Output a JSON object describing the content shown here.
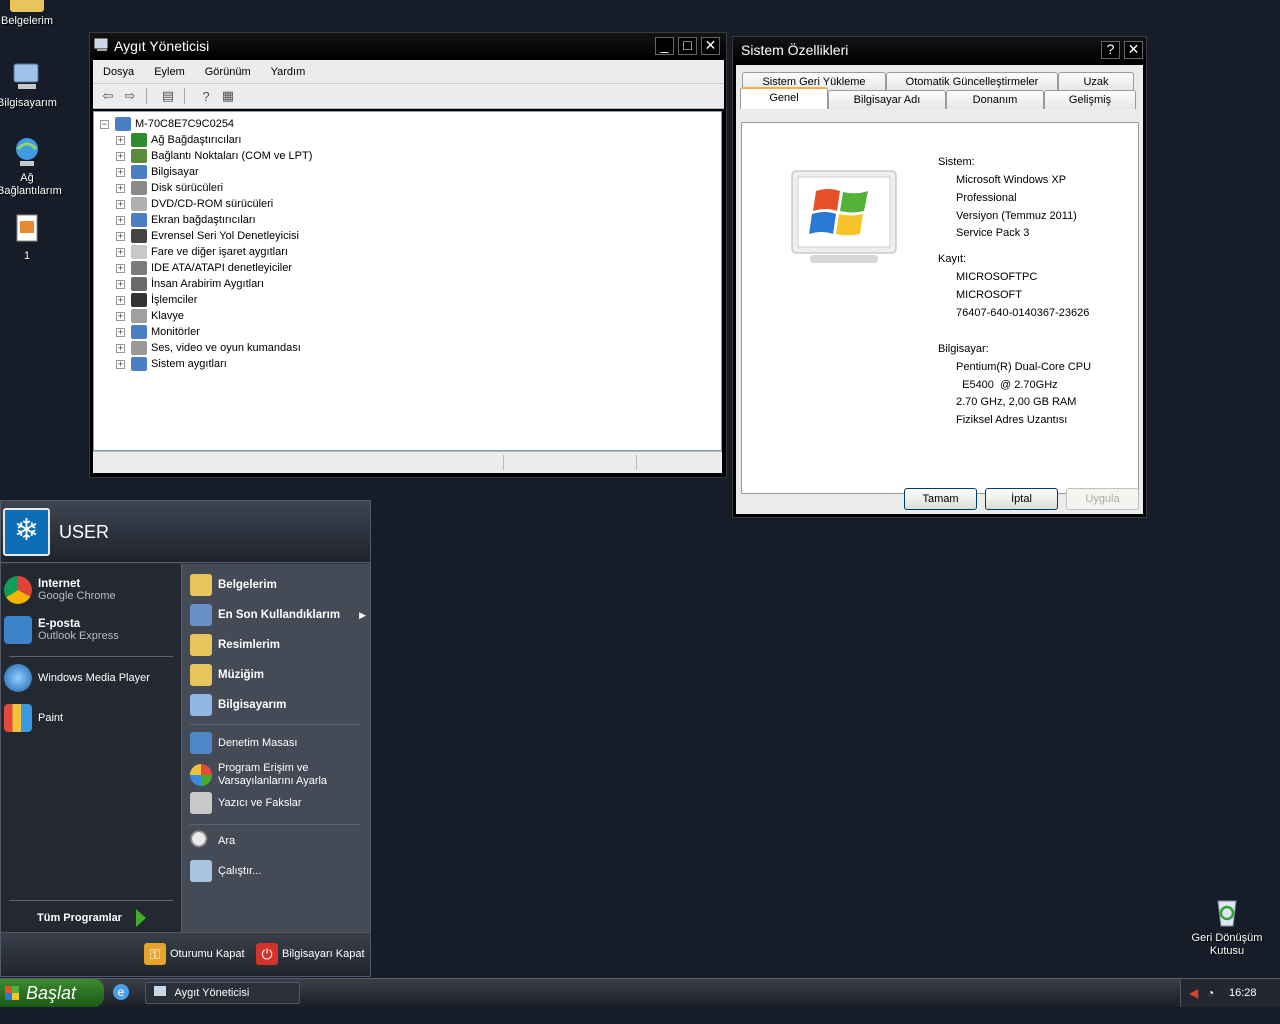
{
  "desktop": {
    "icons": [
      {
        "label": "Belgelerim"
      },
      {
        "label": "Bilgisayarım"
      },
      {
        "label": "Ağ Bağlantılarım"
      },
      {
        "label": "1"
      },
      {
        "label": "Geri Dönüşüm Kutusu"
      }
    ]
  },
  "devmgr": {
    "title": "Aygıt Yöneticisi",
    "menu": [
      "Dosya",
      "Eylem",
      "Görünüm",
      "Yardım"
    ],
    "root": "M-70C8E7C9C0254",
    "items": [
      {
        "label": "Ağ Bağdaştırıcıları",
        "color": "#2e8b2e"
      },
      {
        "label": "Bağlantı Noktaları (COM ve LPT)",
        "color": "#5a8a3a"
      },
      {
        "label": "Bilgisayar",
        "color": "#4a7fc1"
      },
      {
        "label": "Disk sürücüleri",
        "color": "#8a8a8a"
      },
      {
        "label": "DVD/CD-ROM sürücüleri",
        "color": "#b0b0b0"
      },
      {
        "label": "Ekran bağdaştırıcıları",
        "color": "#4a7fc1"
      },
      {
        "label": "Evrensel Seri Yol Denetleyicisi",
        "color": "#444444"
      },
      {
        "label": "Fare ve diğer işaret aygıtları",
        "color": "#c8c8c8"
      },
      {
        "label": "IDE ATA/ATAPI denetleyiciler",
        "color": "#7a7a7a"
      },
      {
        "label": "İnsan Arabirim Aygıtları",
        "color": "#6a6a6a"
      },
      {
        "label": "İşlemciler",
        "color": "#333333"
      },
      {
        "label": "Klavye",
        "color": "#a0a0a0"
      },
      {
        "label": "Monitörler",
        "color": "#4a7fc1"
      },
      {
        "label": "Ses, video ve oyun kumandası",
        "color": "#999999"
      },
      {
        "label": "Sistem aygıtları",
        "color": "#4a7fc1"
      }
    ]
  },
  "sysprops": {
    "title": "Sistem Özellikleri",
    "tabs_top": [
      "Sistem Geri Yükleme",
      "Otomatik Güncelleştirmeler",
      "Uzak"
    ],
    "tabs_bottom": [
      "Genel",
      "Bilgisayar Adı",
      "Donanım",
      "Gelişmiş"
    ],
    "sistem_label": "Sistem:",
    "sistem": [
      "Microsoft Windows XP",
      "Professional",
      "Versiyon (Temmuz 2011)",
      "Service Pack 3"
    ],
    "kayit_label": "Kayıt:",
    "kayit": [
      "MICROSOFTPC",
      "MICROSOFT",
      "76407-640-0140367-23626"
    ],
    "bilgisayar_label": "Bilgisayar:",
    "bilgisayar": [
      "Pentium(R) Dual-Core  CPU",
      "  E5400  @ 2.70GHz",
      "2.70 GHz, 2,00 GB RAM",
      "Fiziksel Adres Uzantısı"
    ],
    "buttons": {
      "ok": "Tamam",
      "cancel": "İptal",
      "apply": "Uygula"
    }
  },
  "startmenu": {
    "user": "USER",
    "pinned": [
      {
        "title": "Internet",
        "sub": "Google Chrome"
      },
      {
        "title": "E-posta",
        "sub": "Outlook Express"
      }
    ],
    "recent": [
      "Windows Media Player",
      "Paint"
    ],
    "all_programs": "Tüm Programlar",
    "places": [
      "Belgelerim",
      "En Son Kullandıklarım",
      "Resimlerim",
      "Müziğim",
      "Bilgisayarım"
    ],
    "settings": [
      "Denetim Masası",
      "Program Erişim ve",
      "Varsayılanlarını Ayarla",
      "Yazıcı ve Fakslar"
    ],
    "tools": [
      "Ara",
      "Çalıştır..."
    ],
    "logoff": "Oturumu Kapat",
    "shutdown": "Bilgisayarı Kapat"
  },
  "taskbar": {
    "start": "Başlat",
    "task": "Aygıt Yöneticisi",
    "clock": "16:28"
  }
}
